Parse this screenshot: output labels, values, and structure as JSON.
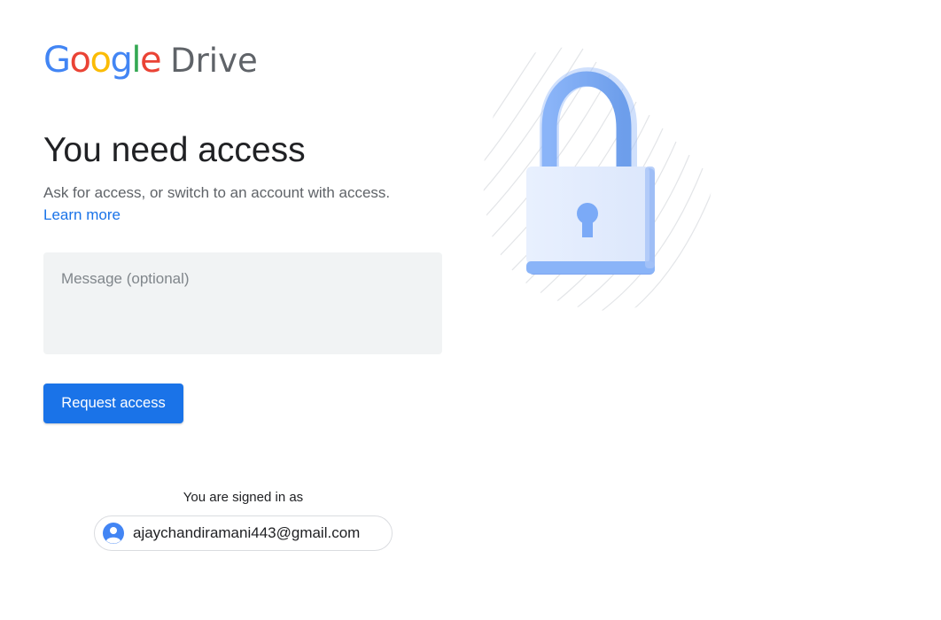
{
  "logo": {
    "google_letters": [
      "G",
      "o",
      "o",
      "g",
      "l",
      "e"
    ],
    "product": "Drive"
  },
  "heading": "You need access",
  "subtext": "Ask for access, or switch to an account with access.",
  "learn_more": "Learn more",
  "message": {
    "placeholder": "Message (optional)",
    "value": ""
  },
  "request_button": "Request access",
  "signed_in": {
    "label": "You are signed in as",
    "email": "ajaychandiramani443@gmail.com"
  },
  "icons": {
    "lock": "lock-illustration",
    "avatar": "account-avatar-icon"
  },
  "colors": {
    "primary": "#1a73e8",
    "google_blue": "#4285f4",
    "google_red": "#ea4335",
    "google_yellow": "#fbbc05",
    "google_green": "#34a853",
    "input_bg": "#f1f3f4"
  }
}
